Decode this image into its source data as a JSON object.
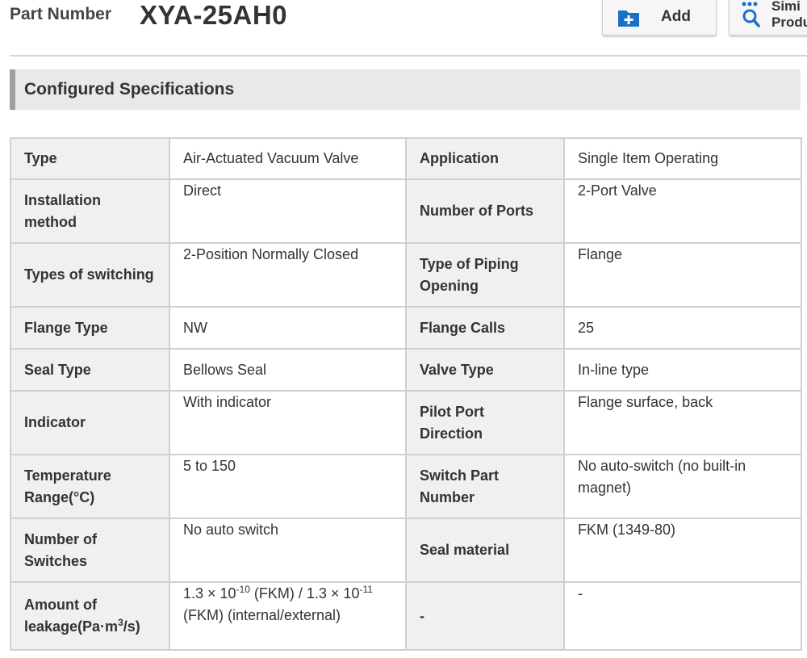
{
  "header": {
    "part_number_label": "Part Number",
    "part_number_value": "XYA-25AH0",
    "add_button_label": "Add",
    "similar_button_line1": "Simi",
    "similar_button_line2": "Produ"
  },
  "section": {
    "title": "Configured Specifications"
  },
  "specs": {
    "rows": [
      {
        "l1": "Type",
        "v1": "Air-Actuated Vacuum Valve",
        "l2": "Application",
        "v2": "Single Item Operating"
      },
      {
        "l1": "Installation method",
        "v1": "Direct",
        "l2": "Number of Ports",
        "v2": "2-Port Valve"
      },
      {
        "l1": "Types of switching",
        "v1": "2-Position Normally Closed",
        "l2": "Type of Piping Opening",
        "v2": "Flange"
      },
      {
        "l1": "Flange Type",
        "v1": "NW",
        "l2": "Flange Calls",
        "v2": "25"
      },
      {
        "l1": "Seal Type",
        "v1": "Bellows Seal",
        "l2": "Valve Type",
        "v2": "In-line type"
      },
      {
        "l1": "Indicator",
        "v1": "With indicator",
        "l2": "Pilot Port Direction",
        "v2": "Flange surface, back"
      },
      {
        "l1": "Temperature Range(°C)",
        "v1": "5 to 150",
        "l2": "Switch Part Number",
        "v2": "No auto-switch (no built-in magnet)"
      },
      {
        "l1": "Number of Switches",
        "v1": "No auto switch",
        "l2": "Seal material",
        "v2": "FKM (1349-80)"
      }
    ],
    "leakage": {
      "label_pre": "Amount of leakage(Pa·m",
      "label_sup": "3",
      "label_post": "/s)",
      "val_a": "1.3 × 10",
      "val_a_exp": "-10",
      "val_b": " (FKM) / 1.3 × 10",
      "val_b_exp": "-11",
      "val_c": " (FKM) (internal/external)",
      "l2": "-",
      "v2": "-"
    }
  },
  "colors": {
    "label_cell_bg": "#f0f0f0",
    "section_bar_bg": "#e9e9e9",
    "add_icon_blue": "#1a6fc9"
  },
  "icons": {
    "add": "folder-plus-icon",
    "similar": "magnifier-icon"
  }
}
